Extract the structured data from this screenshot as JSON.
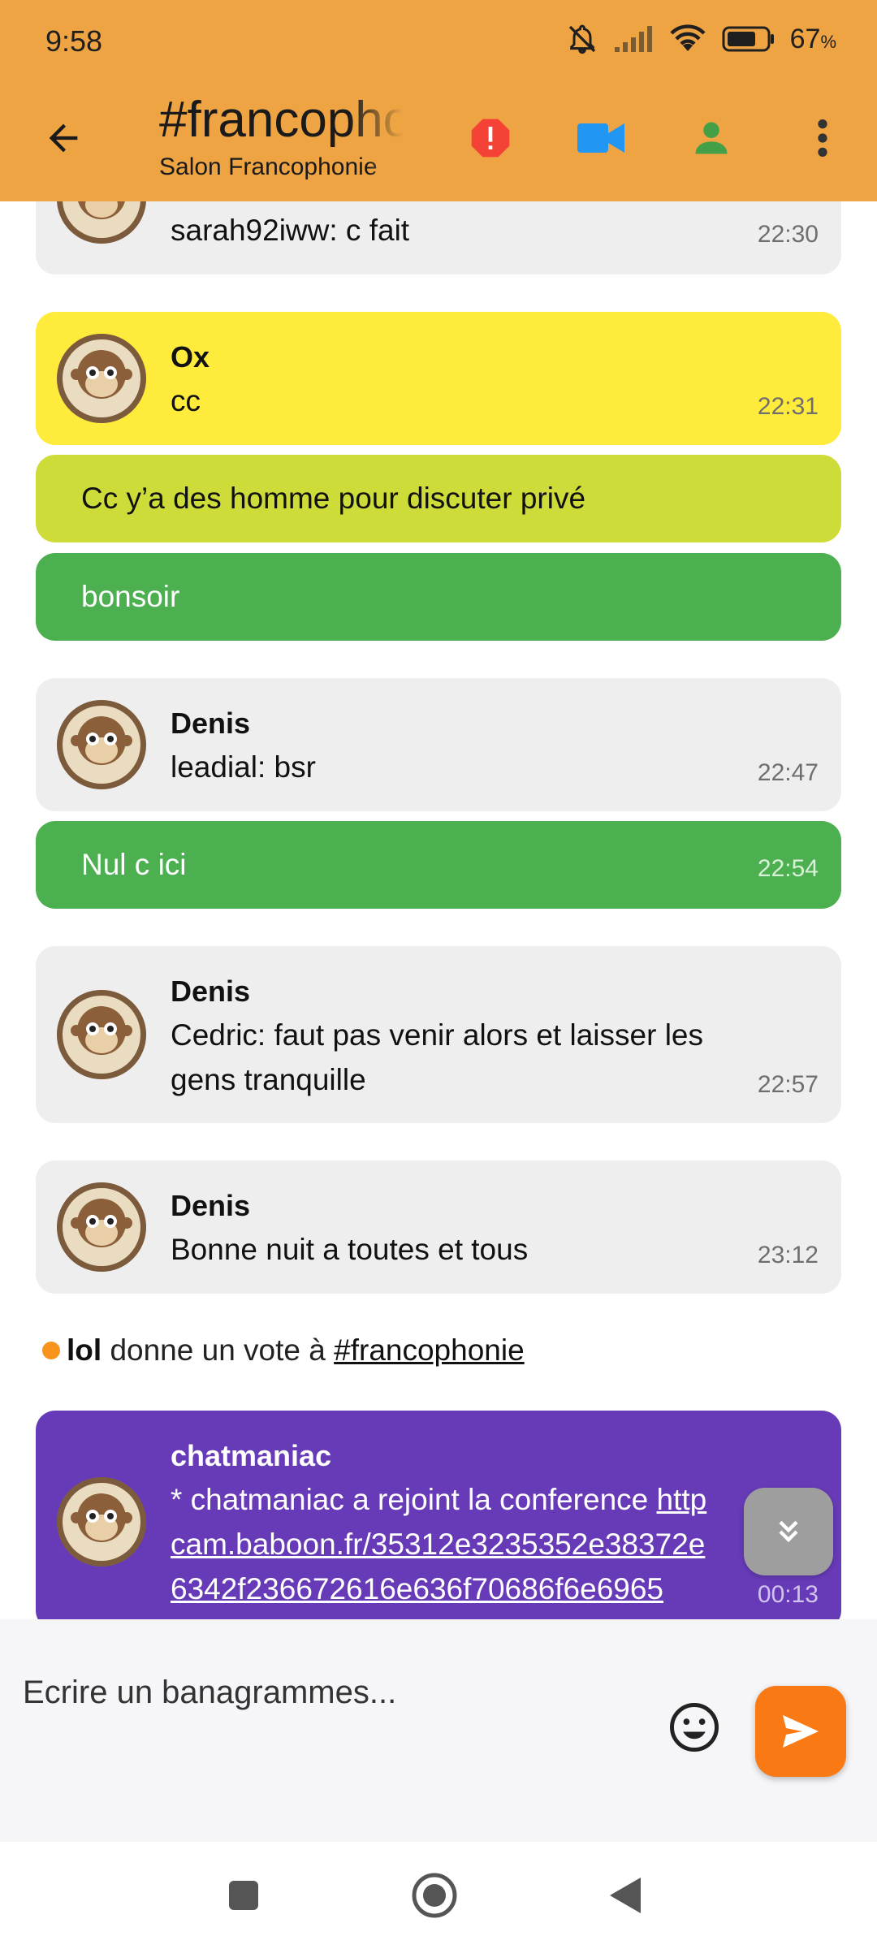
{
  "status_bar": {
    "time": "9:58",
    "battery": "67",
    "battery_unit": "%"
  },
  "header": {
    "title": "#francophonie",
    "subtitle": "Salon Francophonie"
  },
  "colors": {
    "header": "#efa444",
    "bubble_gray": "#eeeeee",
    "bubble_yellow": "#ffeb3b",
    "bubble_lime": "#cddc39",
    "bubble_green": "#4caf50",
    "bubble_purple": "#673ab7",
    "send": "#f97a14",
    "alert": "#f44336",
    "video": "#2196f3",
    "user": "#43a047"
  },
  "icons": {
    "back": "arrow-left-icon",
    "alert": "alert-octagon-icon",
    "video": "video-camera-icon",
    "user": "person-icon",
    "menu": "more-vert-icon",
    "scroll": "chevron-double-down-icon",
    "emoji": "smiley-icon",
    "send": "send-icon"
  },
  "messages": [
    {
      "text": "sarah92iww: c fait",
      "time": "22:30"
    },
    {
      "author": "Ox",
      "text": "cc",
      "time": "22:31"
    },
    {
      "text": "Cc y’a des homme pour discuter privé"
    },
    {
      "text": "bonsoir"
    },
    {
      "author": "Denis",
      "text": "leadial: bsr",
      "time": "22:47"
    },
    {
      "text": "Nul c ici",
      "time": "22:54"
    },
    {
      "author": "Denis",
      "text": "Cedric: faut pas venir alors et laisser les gens tranquille",
      "time": "22:57"
    },
    {
      "author": "Denis",
      "text": "Bonne nuit a toutes et tous",
      "time": "23:12"
    },
    {
      "author": "chatmaniac",
      "text_prefix": "* chatmaniac a rejoint la conference ",
      "link": "https://cam.baboon.fr/35312e3235352e38372e6342f236672616e636f70686f6e6965",
      "link_line1": "http",
      "link_line2": "cam.baboon.fr/35312e3235352e38372e",
      "link_line3": "6342f236672616e636f70686f6e6965",
      "time": "00:13"
    }
  ],
  "event": {
    "user": "lol",
    "action": " donne un vote à ",
    "target": "#francophonie"
  },
  "composer": {
    "placeholder": "Ecrire un banagrammes..."
  }
}
